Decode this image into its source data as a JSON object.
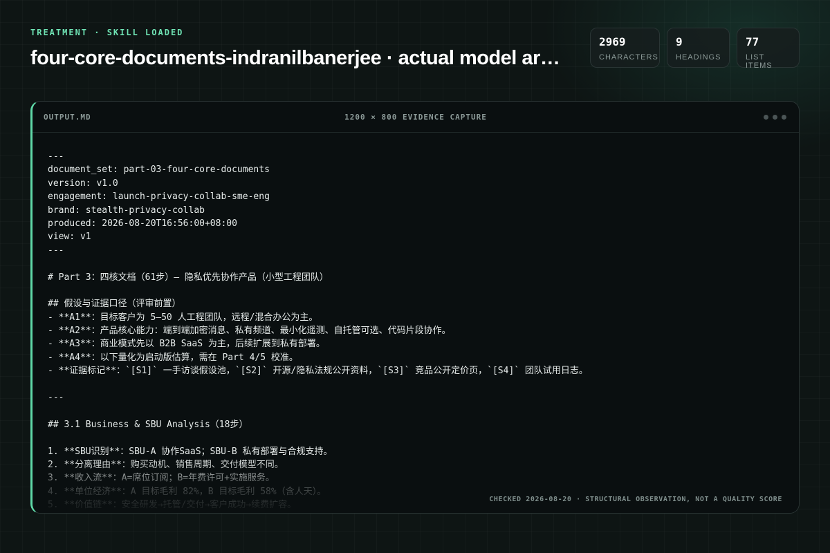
{
  "header": {
    "eyebrow": "TREATMENT · SKILL LOADED",
    "title": "four-core-documents-indranilbanerjee · actual model ar…"
  },
  "stats": [
    {
      "value": "2969",
      "label": "CHARACTERS"
    },
    {
      "value": "9",
      "label": "HEADINGS"
    },
    {
      "value": "77",
      "label": "LIST ITEMS"
    }
  ],
  "panel": {
    "filename": "OUTPUT.MD",
    "caption": "1200 × 800 EVIDENCE CAPTURE",
    "footnote": "CHECKED 2026-08-20 · STRUCTURAL OBSERVATION, NOT A QUALITY SCORE",
    "lines": [
      "---",
      "document_set: part-03-four-core-documents",
      "version: v1.0",
      "engagement: launch-privacy-collab-sme-eng",
      "brand: stealth-privacy-collab",
      "produced: 2026-08-20T16:56:00+08:00",
      "view: v1",
      "---",
      "",
      "# Part 3：四核文档（61步）— 隐私优先协作产品（小型工程团队）",
      "",
      "## 假设与证据口径（评审前置）",
      "- **A1**：目标客户为 5–50 人工程团队，远程/混合办公为主。",
      "- **A2**：产品核心能力：端到端加密消息、私有频道、最小化遥测、自托管可选、代码片段协作。",
      "- **A3**：商业模式先以 B2B SaaS 为主，后续扩展到私有部署。",
      "- **A4**：以下量化为启动版估算，需在 Part 4/5 校准。",
      "- **证据标记**：`[S1]` 一手访谈假设池，`[S2]` 开源/隐私法规公开资料，`[S3]` 竞品公开定价页，`[S4]` 团队试用日志。",
      "",
      "---",
      "",
      "## 3.1 Business & SBU Analysis（18步）",
      "",
      "1. **SBU识别**：SBU-A 协作SaaS；SBU-B 私有部署与合规支持。",
      "2. **分离理由**：购买动机、销售周期、交付模型不同。",
      "3. **收入流**：A=席位订阅；B=年费许可+实施服务。",
      "4. **单位经济**：A 目标毛利 82%，B 目标毛利 58%（含人天）。",
      "5. **价值链**：安全研发→托管/交付→客户成功→续费扩容。"
    ]
  }
}
